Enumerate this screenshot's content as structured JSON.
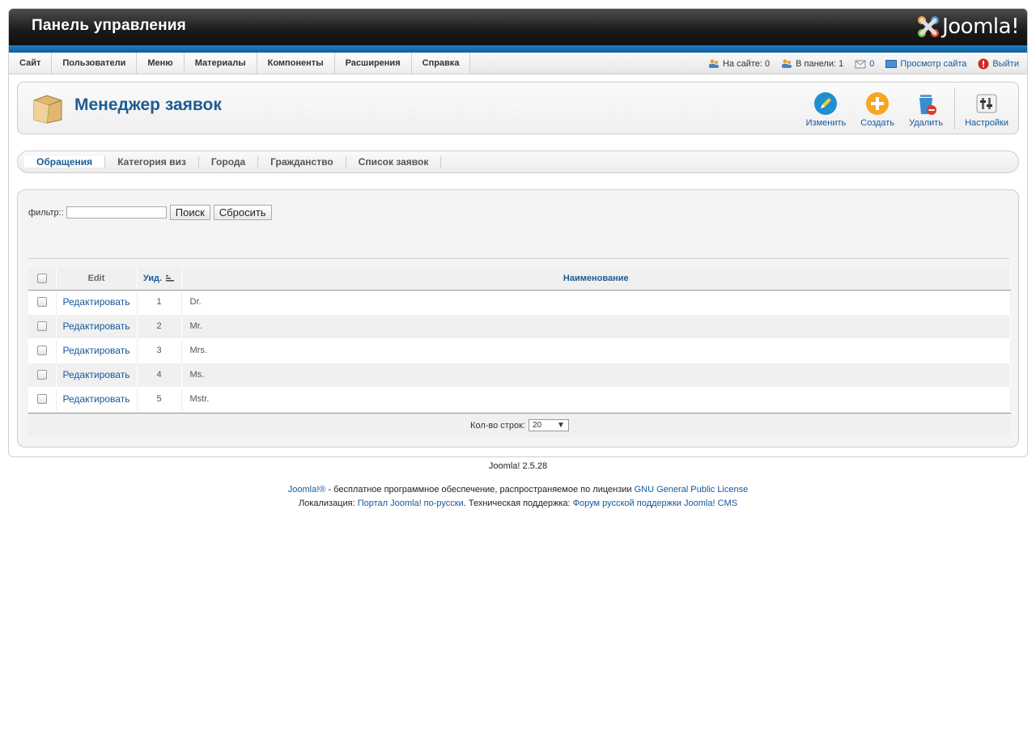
{
  "header": {
    "title": "Панель управления",
    "logo_text": "Joomla!"
  },
  "menu": {
    "items": [
      {
        "label": "Сайт"
      },
      {
        "label": "Пользователи"
      },
      {
        "label": "Меню"
      },
      {
        "label": "Материалы"
      },
      {
        "label": "Компоненты"
      },
      {
        "label": "Расширения"
      },
      {
        "label": "Справка"
      }
    ]
  },
  "status": {
    "on_site": "На сайте: 0",
    "in_panel": "В панели: 1",
    "messages": "0",
    "view_site": "Просмотр сайта",
    "logout": "Выйти"
  },
  "toolbar": {
    "page_title": "Менеджер заявок",
    "edit": "Изменить",
    "create": "Создать",
    "delete": "Удалить",
    "settings": "Настройки"
  },
  "submenu": {
    "items": [
      {
        "label": "Обращения",
        "active": true
      },
      {
        "label": "Категория виз"
      },
      {
        "label": "Города"
      },
      {
        "label": "Гражданство"
      },
      {
        "label": "Список заявок"
      }
    ]
  },
  "filter": {
    "label": "фильтр::",
    "value": "",
    "search_button": "Поиск",
    "reset_button": "Сбросить"
  },
  "table": {
    "headers": {
      "edit": "Edit",
      "id": "Уид.",
      "name": "Наименование"
    },
    "rows": [
      {
        "edit": "Редактировать",
        "id": "1",
        "name": "Dr."
      },
      {
        "edit": "Редактировать",
        "id": "2",
        "name": "Mr."
      },
      {
        "edit": "Редактировать",
        "id": "3",
        "name": "Mrs."
      },
      {
        "edit": "Редактировать",
        "id": "4",
        "name": "Ms."
      },
      {
        "edit": "Редактировать",
        "id": "5",
        "name": "Mstr."
      }
    ],
    "rows_label": "Кол-во строк:",
    "rows_value": "20"
  },
  "footer": {
    "version": "Joomla! 2.5.28",
    "joomla_link": "Joomla!®",
    "license_text": " - бесплатное программное обеспечение, распространяемое по лицензии ",
    "license_link": "GNU General Public License",
    "loc_label": "Локализация: ",
    "portal_link": "Портал Joomla! по-русски",
    "support_label": ". Техническая поддержка: ",
    "forum_link": "Форум русской поддержки Joomla! CMS"
  },
  "colors": {
    "accent": "#14589c",
    "title": "#1d5c93",
    "header_bg": "#1a1a1a",
    "band": "#1d7ec4"
  }
}
